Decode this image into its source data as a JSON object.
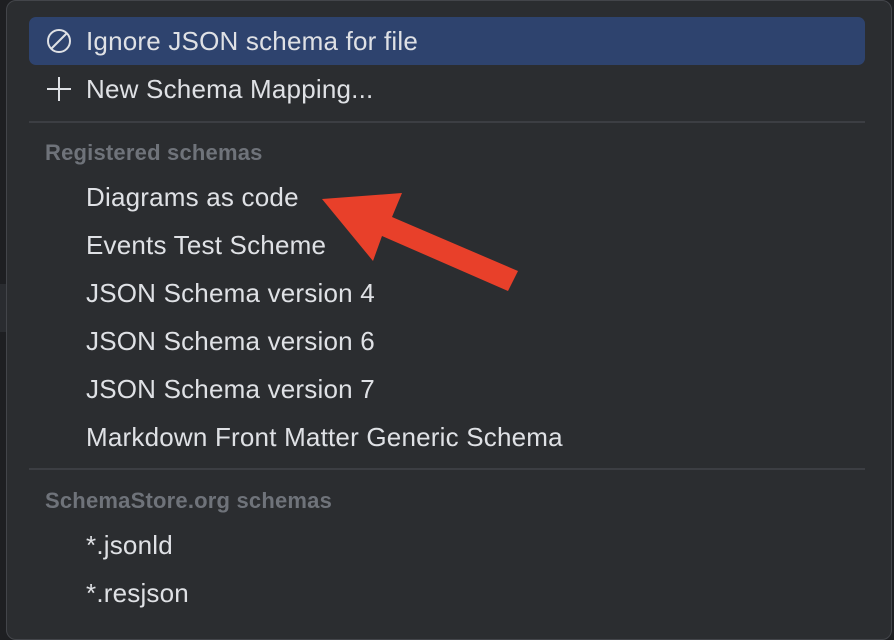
{
  "menu": {
    "actions": [
      {
        "label": "Ignore JSON schema for file",
        "icon": "ignore-circle-slash-icon",
        "selected": true
      },
      {
        "label": "New Schema Mapping...",
        "icon": "plus-icon",
        "selected": false
      }
    ],
    "registered": {
      "header": "Registered schemas",
      "items": [
        "Diagrams as code",
        "Events Test Scheme",
        "JSON Schema version 4",
        "JSON Schema version 6",
        "JSON Schema version 7",
        "Markdown Front Matter Generic Schema"
      ]
    },
    "schemastore": {
      "header": "SchemaStore.org schemas",
      "items": [
        "*.jsonld",
        "*.resjson"
      ]
    }
  },
  "annotation": {
    "type": "arrow",
    "color": "#e8402a",
    "points_to": "Diagrams as code"
  },
  "colors": {
    "popup_bg": "#2b2d30",
    "selection_bg": "#2e436e",
    "text": "#dfe1e5",
    "header_text": "#6f737a",
    "separator": "#3c3e43"
  }
}
